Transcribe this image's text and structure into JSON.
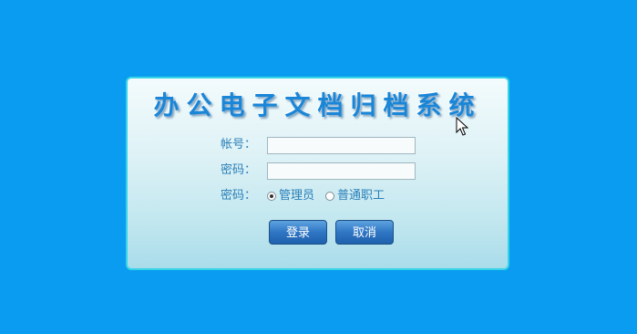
{
  "app": {
    "title": "办公电子文档归档系统"
  },
  "form": {
    "account_label": "帐号：",
    "account_value": "",
    "password_label": "密码：",
    "password_value": "",
    "role_label": "密码：",
    "roles": [
      {
        "label": "管理员",
        "checked": true
      },
      {
        "label": "普通职工",
        "checked": false
      }
    ]
  },
  "buttons": {
    "login_label": "登录",
    "cancel_label": "取消"
  },
  "colors": {
    "background": "#0a9cf0",
    "accent": "#1a86d8",
    "button": "#2f76c4"
  }
}
